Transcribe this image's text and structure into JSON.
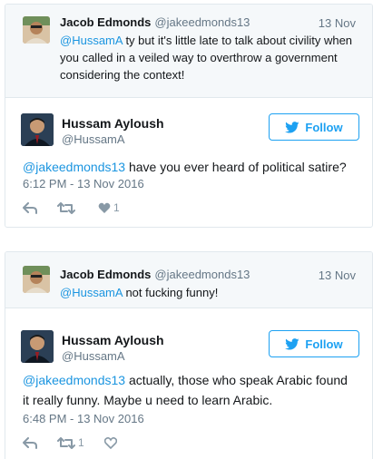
{
  "tweet1": {
    "reply": {
      "name": "Jacob Edmonds",
      "handle": "@jakeedmonds13",
      "date": "13 Nov",
      "mention": "@HussamA",
      "text_line1": " ty but it's little late to talk about civility when",
      "text_line2": "you called in a veiled way to overthrow a government",
      "text_line3": "considering the context!"
    },
    "main": {
      "name": "Hussam Ayloush",
      "handle": "@HussamA",
      "follow_label": "Follow",
      "mention": "@jakeedmonds13",
      "text": " have you ever heard of political satire?",
      "timestamp": "6:12 PM - 13 Nov 2016",
      "like_count": "1",
      "retweet_count": ""
    }
  },
  "tweet2": {
    "reply": {
      "name": "Jacob Edmonds",
      "handle": "@jakeedmonds13",
      "date": "13 Nov",
      "mention": "@HussamA",
      "text_line1": " not fucking funny!"
    },
    "main": {
      "name": "Hussam Ayloush",
      "handle": "@HussamA",
      "follow_label": "Follow",
      "mention": "@jakeedmonds13",
      "text_line1": " actually, those who speak Arabic found",
      "text_line2": "it really funny. Maybe u need to learn Arabic.",
      "timestamp": "6:48 PM - 13 Nov 2016",
      "retweet_count": "1",
      "like_count": ""
    }
  },
  "colors": {
    "twitter_blue": "#1da1f2",
    "mention_blue": "#1b95e0",
    "meta_gray": "#657786",
    "icon_gray": "#aab8c2",
    "border": "#e1e8ed",
    "reply_bg": "#f5f8fa"
  },
  "icons": [
    "reply-icon",
    "retweet-icon",
    "like-icon",
    "twitter-bird-icon"
  ]
}
